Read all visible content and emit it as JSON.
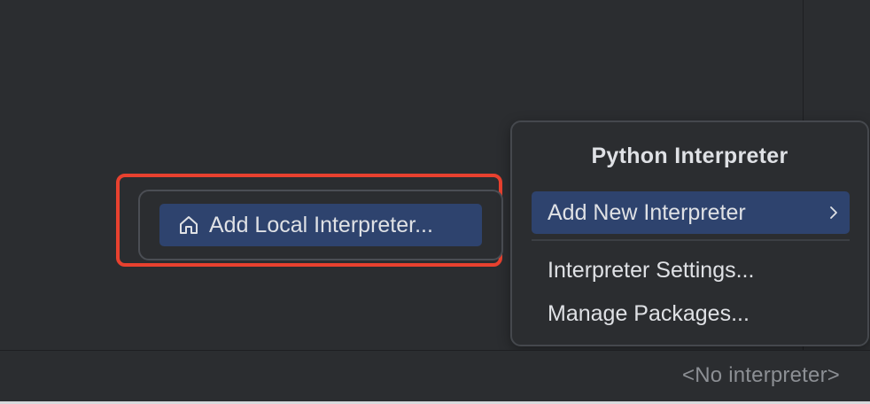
{
  "status_bar": {
    "interpreter_label": "<No interpreter>"
  },
  "local_popup": {
    "button_label": "Add Local Interpreter...",
    "icon": "home-icon"
  },
  "interpreter_popup": {
    "title": "Python Interpreter",
    "items": [
      {
        "label": "Add New Interpreter",
        "has_submenu": true,
        "selected": true
      },
      {
        "label": "Interpreter Settings...",
        "has_submenu": false,
        "selected": false
      },
      {
        "label": "Manage Packages...",
        "has_submenu": false,
        "selected": false
      }
    ]
  },
  "colors": {
    "background": "#2b2d30",
    "selection": "#2e436e",
    "highlight_border": "#e8412f",
    "text": "#dfe1e5",
    "muted_text": "#8c8f94"
  }
}
